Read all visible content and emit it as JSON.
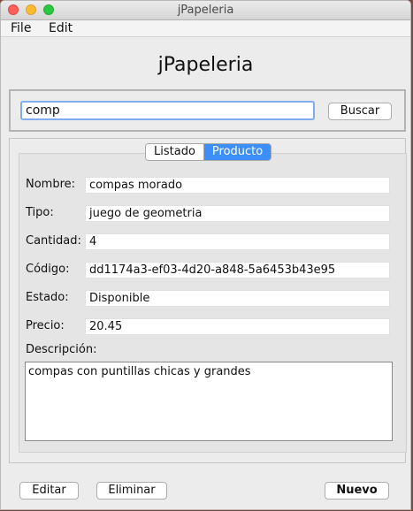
{
  "window": {
    "title": "jPapeleria"
  },
  "menu": {
    "file": "File",
    "edit": "Edit"
  },
  "app_title": "jPapeleria",
  "search": {
    "value": "comp",
    "button": "Buscar"
  },
  "tabs": {
    "listado": "Listado",
    "producto": "Producto",
    "active": "Producto"
  },
  "fields": {
    "nombre": {
      "label": "Nombre:",
      "value": "compas morado"
    },
    "tipo": {
      "label": "Tipo:",
      "value": "juego de geometria"
    },
    "cantidad": {
      "label": "Cantidad:",
      "value": "4"
    },
    "codigo": {
      "label": "Código:",
      "value": "dd1174a3-ef03-4d20-a848-5a6453b43e95"
    },
    "estado": {
      "label": "Estado:",
      "value": "Disponible"
    },
    "precio": {
      "label": "Precio:",
      "value": "20.45"
    },
    "descripcion": {
      "label": "Descripción:",
      "value": "compas con puntillas chicas y grandes"
    }
  },
  "actions": {
    "editar": "Editar",
    "eliminar": "Eliminar",
    "nuevo": "Nuevo"
  }
}
